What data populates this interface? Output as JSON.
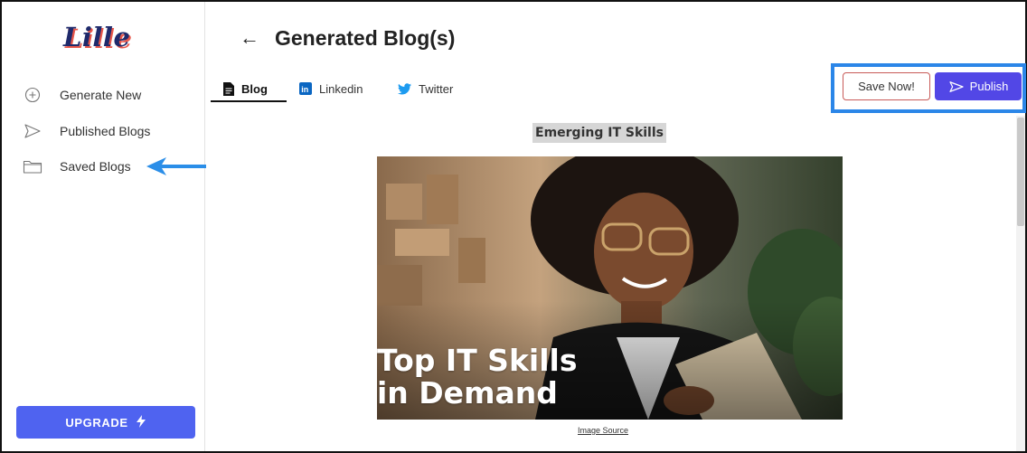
{
  "app": {
    "logo_text": "Lille"
  },
  "sidebar": {
    "items": [
      {
        "label": "Generate New",
        "icon": "plus-circle-icon"
      },
      {
        "label": "Published Blogs",
        "icon": "send-icon"
      },
      {
        "label": "Saved Blogs",
        "icon": "folder-icon"
      }
    ],
    "upgrade_label": "UPGRADE",
    "upgrade_icon": "lightning-icon"
  },
  "header": {
    "back_icon": "back-arrow-icon",
    "back_glyph": "←",
    "title": "Generated Blog(s)"
  },
  "tabs": [
    {
      "label": "Blog",
      "icon": "document-icon",
      "active": true
    },
    {
      "label": "Linkedin",
      "icon": "linkedin-icon",
      "active": false
    },
    {
      "label": "Twitter",
      "icon": "twitter-icon",
      "active": false
    }
  ],
  "actions": {
    "save_label": "Save Now!",
    "publish_label": "Publish",
    "publish_icon": "send-icon"
  },
  "content": {
    "heading": "Emerging IT Skills",
    "image_text_line1": "Top IT Skills",
    "image_text_line2": "in Demand",
    "image_source_label": "Image Source"
  },
  "colors": {
    "accent": "#5247e6",
    "upgrade": "#4f63f0",
    "highlight_box": "#2b86e8",
    "pointer_arrow": "#2b8ee8",
    "logo": "#1f2a6b",
    "logo_shadow": "#e8564a",
    "linkedin": "#0a66c2",
    "twitter": "#1d9bf0"
  }
}
